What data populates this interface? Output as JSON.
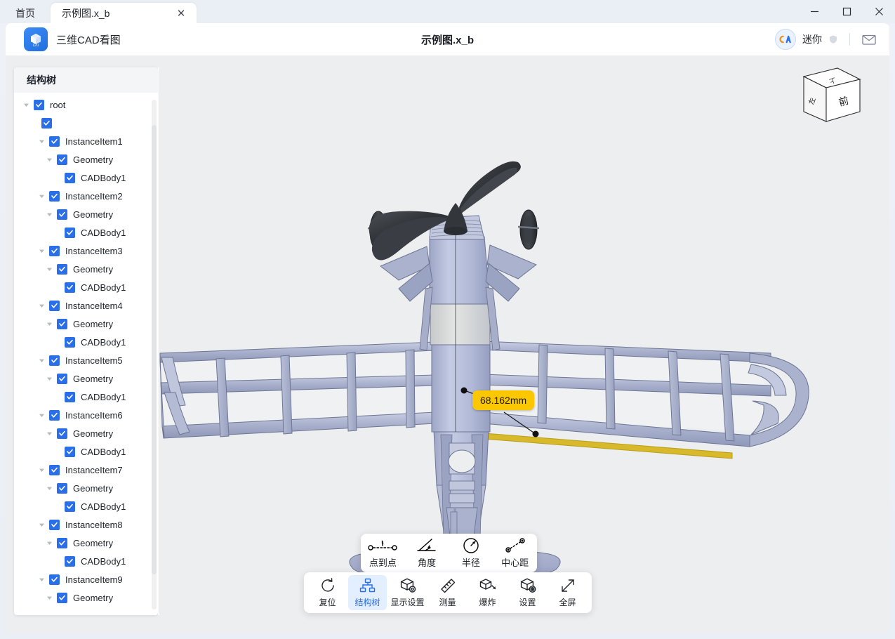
{
  "window": {
    "tabs": [
      {
        "label": "首页",
        "active": false
      },
      {
        "label": "示例图.x_b",
        "active": true
      }
    ],
    "close_tab_glyph": "✕",
    "controls": {
      "minimize": "minimize-icon",
      "maximize": "maximize-icon",
      "close": "close-icon"
    }
  },
  "header": {
    "app_name": "三维CAD看图",
    "title": "示例图.x_b",
    "logo_icon": "cube-logo-icon",
    "user": {
      "name": "迷你",
      "avatar_icon": "cad-avatar-icon",
      "badge_icon": "shield-badge-icon"
    },
    "mail_icon": "mail-icon"
  },
  "sidebar": {
    "title": "结构树",
    "tree": [
      {
        "label": "root",
        "depth": 0,
        "caret": true,
        "checked": true
      },
      {
        "label": "",
        "depth": 1,
        "caret": false,
        "checked": true
      },
      {
        "label": "InstanceItem1",
        "depth": 2,
        "caret": true,
        "checked": true
      },
      {
        "label": "Geometry",
        "depth": 3,
        "caret": true,
        "checked": true
      },
      {
        "label": "CADBody1",
        "depth": 4,
        "caret": false,
        "checked": true
      },
      {
        "label": "InstanceItem2",
        "depth": 2,
        "caret": true,
        "checked": true
      },
      {
        "label": "Geometry",
        "depth": 3,
        "caret": true,
        "checked": true
      },
      {
        "label": "CADBody1",
        "depth": 4,
        "caret": false,
        "checked": true
      },
      {
        "label": "InstanceItem3",
        "depth": 2,
        "caret": true,
        "checked": true
      },
      {
        "label": "Geometry",
        "depth": 3,
        "caret": true,
        "checked": true
      },
      {
        "label": "CADBody1",
        "depth": 4,
        "caret": false,
        "checked": true
      },
      {
        "label": "InstanceItem4",
        "depth": 2,
        "caret": true,
        "checked": true
      },
      {
        "label": "Geometry",
        "depth": 3,
        "caret": true,
        "checked": true
      },
      {
        "label": "CADBody1",
        "depth": 4,
        "caret": false,
        "checked": true
      },
      {
        "label": "InstanceItem5",
        "depth": 2,
        "caret": true,
        "checked": true
      },
      {
        "label": "Geometry",
        "depth": 3,
        "caret": true,
        "checked": true
      },
      {
        "label": "CADBody1",
        "depth": 4,
        "caret": false,
        "checked": true
      },
      {
        "label": "InstanceItem6",
        "depth": 2,
        "caret": true,
        "checked": true
      },
      {
        "label": "Geometry",
        "depth": 3,
        "caret": true,
        "checked": true
      },
      {
        "label": "CADBody1",
        "depth": 4,
        "caret": false,
        "checked": true
      },
      {
        "label": "InstanceItem7",
        "depth": 2,
        "caret": true,
        "checked": true
      },
      {
        "label": "Geometry",
        "depth": 3,
        "caret": true,
        "checked": true
      },
      {
        "label": "CADBody1",
        "depth": 4,
        "caret": false,
        "checked": true
      },
      {
        "label": "InstanceItem8",
        "depth": 2,
        "caret": true,
        "checked": true
      },
      {
        "label": "Geometry",
        "depth": 3,
        "caret": true,
        "checked": true
      },
      {
        "label": "CADBody1",
        "depth": 4,
        "caret": false,
        "checked": true
      },
      {
        "label": "InstanceItem9",
        "depth": 2,
        "caret": true,
        "checked": true
      },
      {
        "label": "Geometry",
        "depth": 3,
        "caret": true,
        "checked": true
      }
    ]
  },
  "viewport": {
    "measurement_label": "68.162mm",
    "nav_cube": {
      "front_face": "前",
      "left_face": "左",
      "top_face": "上"
    },
    "model": "model-airplane-front-view"
  },
  "measure_popup": {
    "items": [
      {
        "label": "点到点",
        "icon": "point-to-point-icon"
      },
      {
        "label": "角度",
        "icon": "angle-icon"
      },
      {
        "label": "半径",
        "icon": "radius-icon"
      },
      {
        "label": "中心距",
        "icon": "center-distance-icon"
      }
    ]
  },
  "toolbar": {
    "items": [
      {
        "label": "复位",
        "icon": "reset-icon",
        "active": false
      },
      {
        "label": "结构树",
        "icon": "structure-tree-icon",
        "active": true
      },
      {
        "label": "显示设置",
        "icon": "display-settings-icon",
        "active": false
      },
      {
        "label": "测量",
        "icon": "measure-ruler-icon",
        "active": false
      },
      {
        "label": "爆炸",
        "icon": "explode-icon",
        "active": false
      },
      {
        "label": "设置",
        "icon": "settings-icon",
        "active": false
      },
      {
        "label": "全屏",
        "icon": "fullscreen-icon",
        "active": false
      }
    ]
  },
  "colors": {
    "accent": "#2a6ee8",
    "measure_yellow": "#fbc700",
    "model_body": "#b6bdd8",
    "canvas_bg": "#edeeef"
  }
}
